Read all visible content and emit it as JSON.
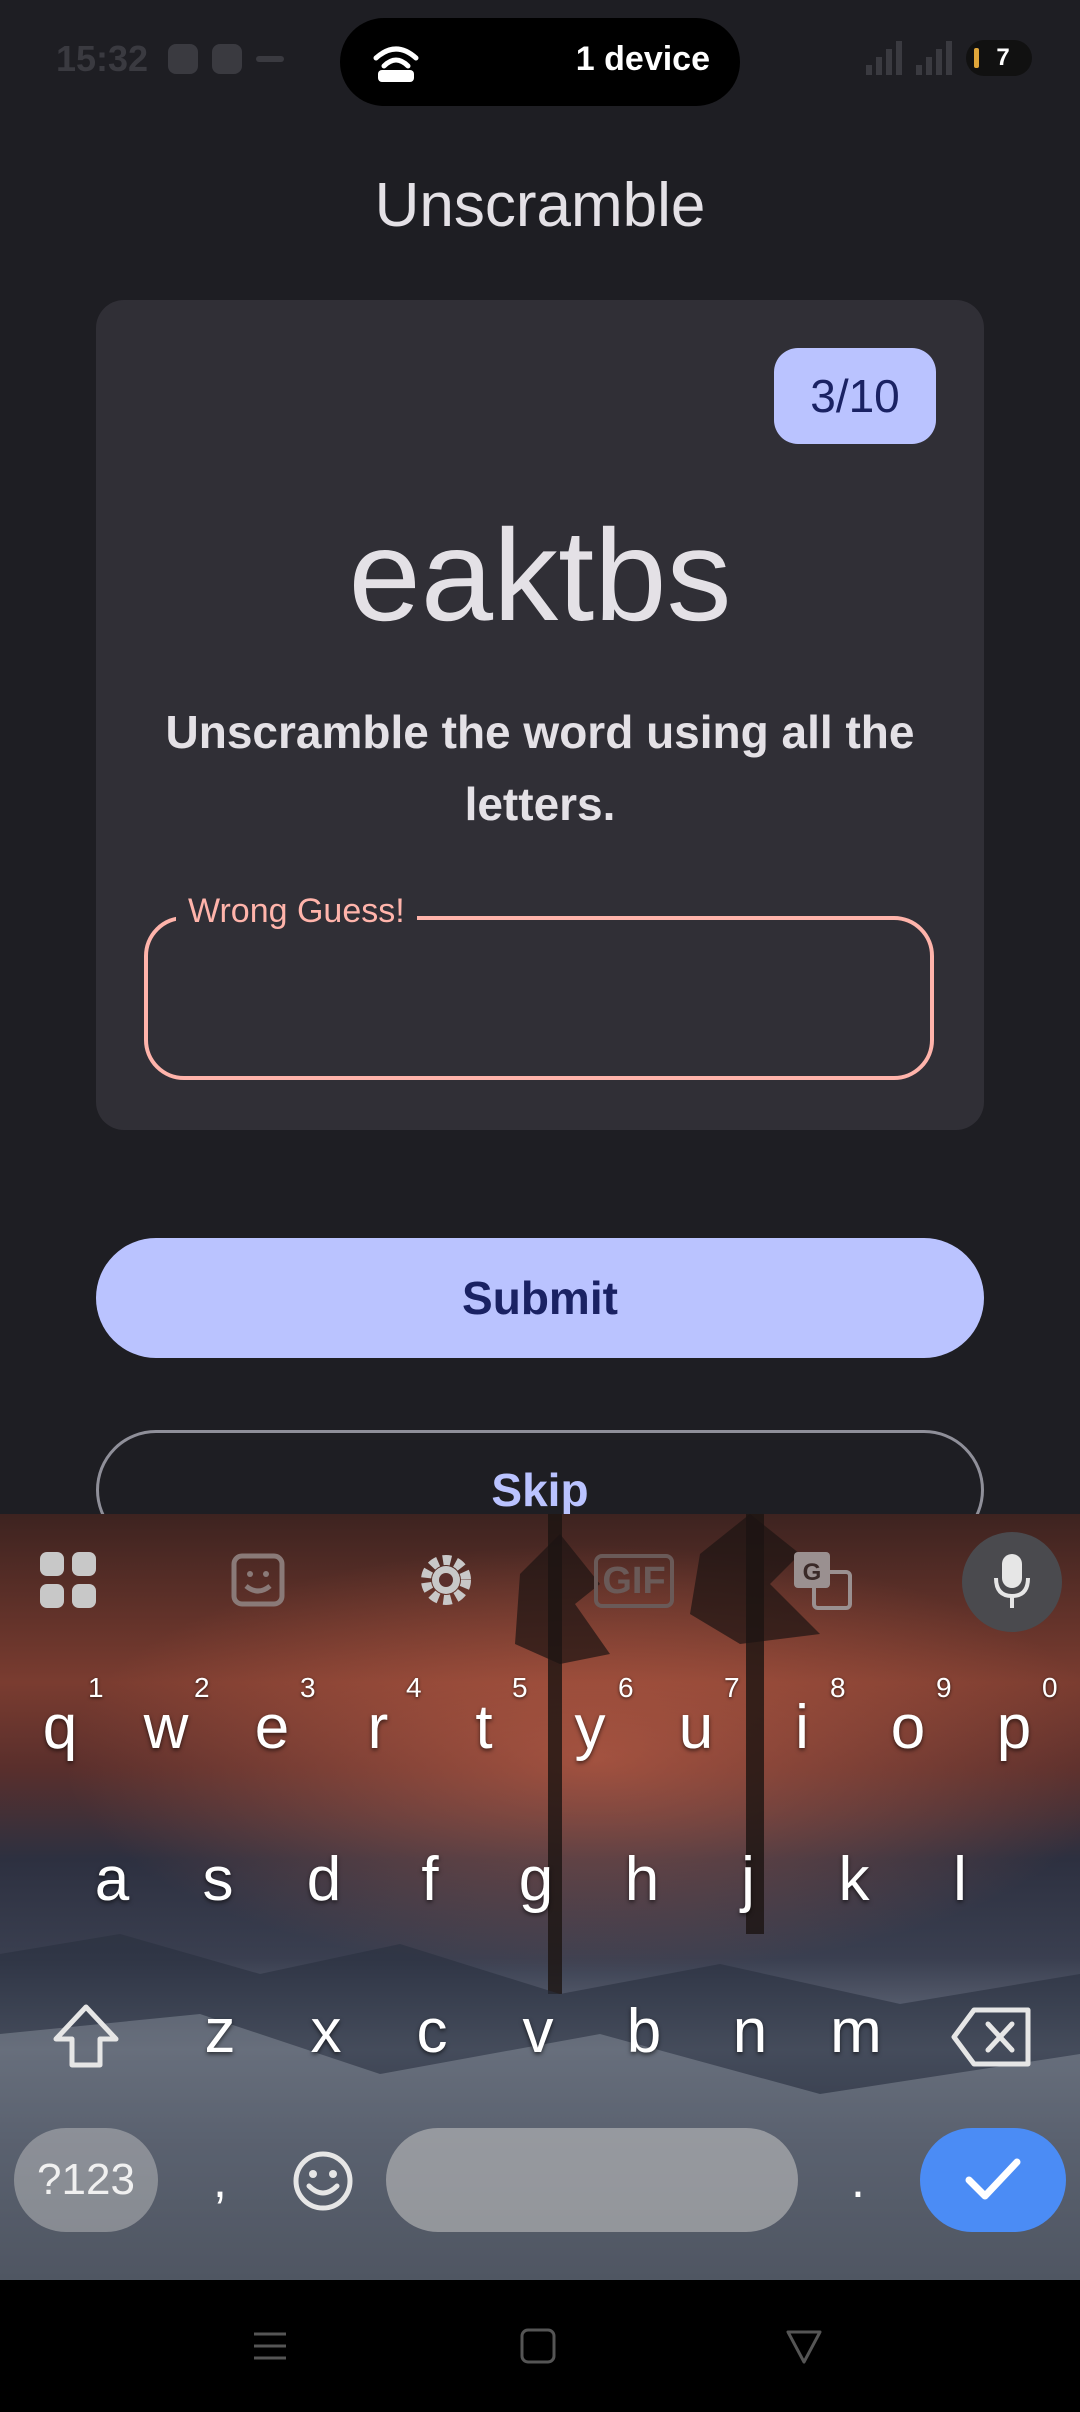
{
  "status_bar": {
    "time": "15:32",
    "pill_text": "1 device",
    "battery": "7",
    "icons": [
      "chat-icon",
      "app-icon",
      "hotspot-icon",
      "signal-icon",
      "battery-icon"
    ]
  },
  "app": {
    "title": "Unscramble",
    "progress": "3/10",
    "scrambled_word": "eaktbs",
    "instructions": "Unscramble the word using all the letters.",
    "guess_label": "Wrong Guess!",
    "guess_value": "",
    "submit_label": "Submit",
    "skip_label": "Skip"
  },
  "colors": {
    "background": "#1e1e23",
    "card": "#302f36",
    "primary_container": "#bac3ff",
    "on_primary_container": "#1a2263",
    "error": "#ffb4ab"
  },
  "keyboard": {
    "toolbar_icons": [
      "apps-grid-icon",
      "sticker-icon",
      "settings-gear-icon",
      "gif-icon",
      "translate-icon",
      "microphone-icon"
    ],
    "gif_label": "GIF",
    "row1": [
      "q",
      "w",
      "e",
      "r",
      "t",
      "y",
      "u",
      "i",
      "o",
      "p"
    ],
    "row1_hints": [
      "1",
      "2",
      "3",
      "4",
      "5",
      "6",
      "7",
      "8",
      "9",
      "0"
    ],
    "row2": [
      "a",
      "s",
      "d",
      "f",
      "g",
      "h",
      "j",
      "k",
      "l"
    ],
    "row3": [
      "z",
      "x",
      "c",
      "v",
      "b",
      "n",
      "m"
    ],
    "mode_label": "?123",
    "comma": ",",
    "period": "."
  },
  "nav_bar": {
    "icons": [
      "menu-icon",
      "home-icon",
      "back-icon"
    ]
  }
}
